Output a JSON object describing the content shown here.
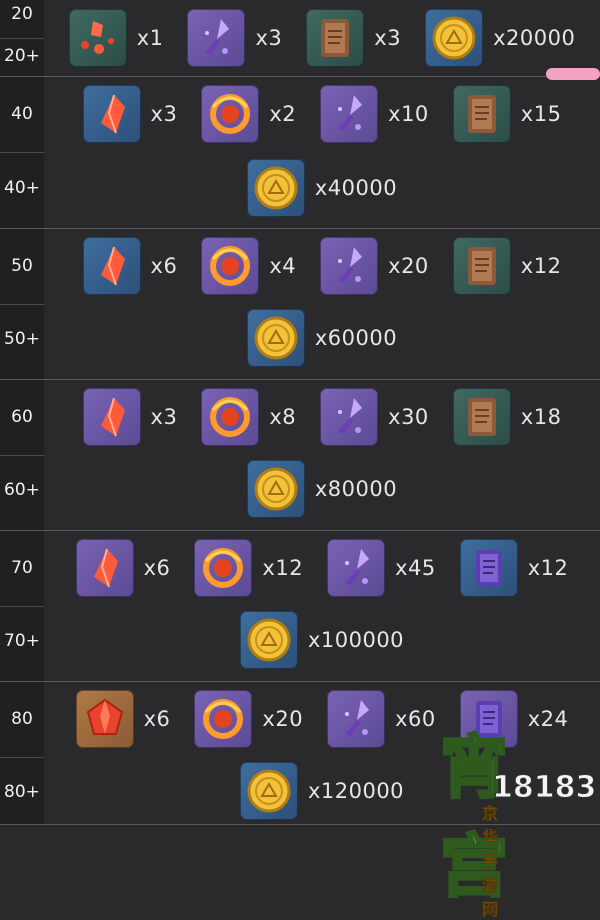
{
  "tiers": [
    {
      "level": "20",
      "level_plus": "20+",
      "row1": [
        {
          "icon": "fragment-gem-icon",
          "qty": "x1",
          "bg": "green"
        },
        {
          "icon": "purple-spirit-icon",
          "qty": "x3",
          "bg": "purple"
        },
        {
          "icon": "scroll-icon",
          "qty": "x3",
          "bg": "green"
        },
        {
          "icon": "gold-coin-icon",
          "qty": "x20000",
          "bg": "blue"
        }
      ],
      "row2": []
    },
    {
      "level": "40",
      "level_plus": "40+",
      "row1": [
        {
          "icon": "red-crystal-icon",
          "qty": "x3",
          "bg": "blue"
        },
        {
          "icon": "fire-ring-icon",
          "qty": "x2",
          "bg": "purple"
        },
        {
          "icon": "purple-spirit-icon",
          "qty": "x10",
          "bg": "purple"
        },
        {
          "icon": "scroll-icon",
          "qty": "x15",
          "bg": "green"
        }
      ],
      "row2": [
        {
          "icon": "gold-coin-icon",
          "qty": "x40000",
          "bg": "blue"
        }
      ]
    },
    {
      "level": "50",
      "level_plus": "50+",
      "row1": [
        {
          "icon": "red-crystal-icon",
          "qty": "x6",
          "bg": "blue"
        },
        {
          "icon": "fire-ring-icon",
          "qty": "x4",
          "bg": "purple"
        },
        {
          "icon": "purple-spirit-icon",
          "qty": "x20",
          "bg": "purple"
        },
        {
          "icon": "scroll-icon",
          "qty": "x12",
          "bg": "green"
        }
      ],
      "row2": [
        {
          "icon": "gold-coin-icon",
          "qty": "x60000",
          "bg": "blue"
        }
      ]
    },
    {
      "level": "60",
      "level_plus": "60+",
      "row1": [
        {
          "icon": "red-crystal-icon",
          "qty": "x3",
          "bg": "purple"
        },
        {
          "icon": "fire-ring-icon",
          "qty": "x8",
          "bg": "purple"
        },
        {
          "icon": "purple-spirit-icon",
          "qty": "x30",
          "bg": "purple"
        },
        {
          "icon": "scroll-icon",
          "qty": "x18",
          "bg": "green"
        }
      ],
      "row2": [
        {
          "icon": "gold-coin-icon",
          "qty": "x80000",
          "bg": "blue"
        }
      ]
    },
    {
      "level": "70",
      "level_plus": "70+",
      "row1": [
        {
          "icon": "red-crystal-icon",
          "qty": "x6",
          "bg": "purple"
        },
        {
          "icon": "fire-ring-icon",
          "qty": "x12",
          "bg": "purple"
        },
        {
          "icon": "purple-spirit-icon",
          "qty": "x45",
          "bg": "purple"
        },
        {
          "icon": "purple-scroll-icon",
          "qty": "x12",
          "bg": "blue"
        }
      ],
      "row2": [
        {
          "icon": "gold-coin-icon",
          "qty": "x100000",
          "bg": "blue"
        }
      ]
    },
    {
      "level": "80",
      "level_plus": "80+",
      "row1": [
        {
          "icon": "red-gem-icon",
          "qty": "x6",
          "bg": "orange"
        },
        {
          "icon": "fire-ring-icon",
          "qty": "x20",
          "bg": "purple"
        },
        {
          "icon": "purple-spirit-icon",
          "qty": "x60",
          "bg": "purple"
        },
        {
          "icon": "purple-scroll-icon",
          "qty": "x24",
          "bg": "purple"
        }
      ],
      "row2": [
        {
          "icon": "gold-coin-icon",
          "qty": "x120000",
          "bg": "blue"
        }
      ]
    }
  ],
  "watermark": {
    "chars": "宵宫",
    "number": "18183",
    "site": "京华手游网"
  },
  "colors": {
    "background": "#2a2a2c",
    "left_column": "#202022",
    "scroll_handle": "#f3a2c3"
  }
}
